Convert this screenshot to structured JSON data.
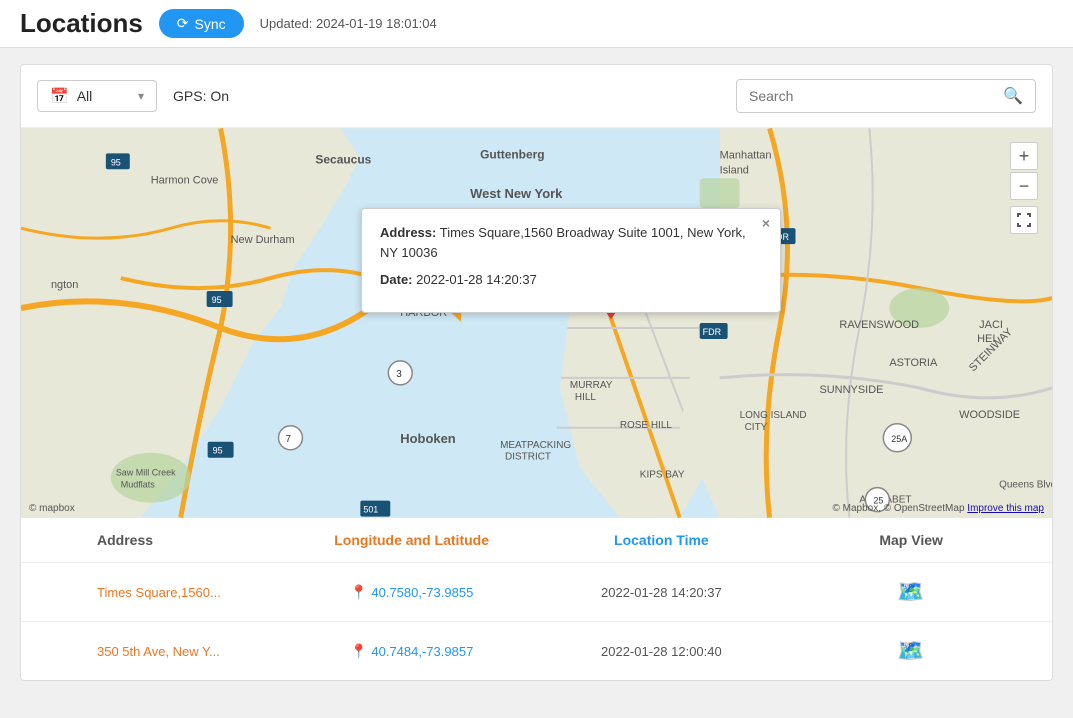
{
  "header": {
    "title": "Locations",
    "sync_button": "Sync",
    "updated_text": "Updated: 2024-01-19 18:01:04"
  },
  "toolbar": {
    "filter_label": "All",
    "gps_status": "GPS: On",
    "search_placeholder": "Search"
  },
  "map": {
    "popup": {
      "address_label": "Address:",
      "address_value": "Times Square,1560 Broadway Suite 1001, New York, NY 10036",
      "date_label": "Date:",
      "date_value": "2022-01-28 14:20:37",
      "close": "×"
    },
    "zoom_in": "+",
    "zoom_out": "−",
    "attribution": "© Mapbox, © OpenStreetMap",
    "improve_link": "Improve this map",
    "logo": "© mapbox"
  },
  "table": {
    "columns": [
      "Address",
      "Longitude and Latitude",
      "Location Time",
      "Map View"
    ],
    "rows": [
      {
        "address": "Times Square,1560...",
        "coords": "40.7580,-73.9855",
        "time": "2022-01-28 14:20:37",
        "has_map": true
      },
      {
        "address": "350 5th Ave, New Y...",
        "coords": "40.7484,-73.9857",
        "time": "2022-01-28 12:00:40",
        "has_map": true
      }
    ]
  }
}
